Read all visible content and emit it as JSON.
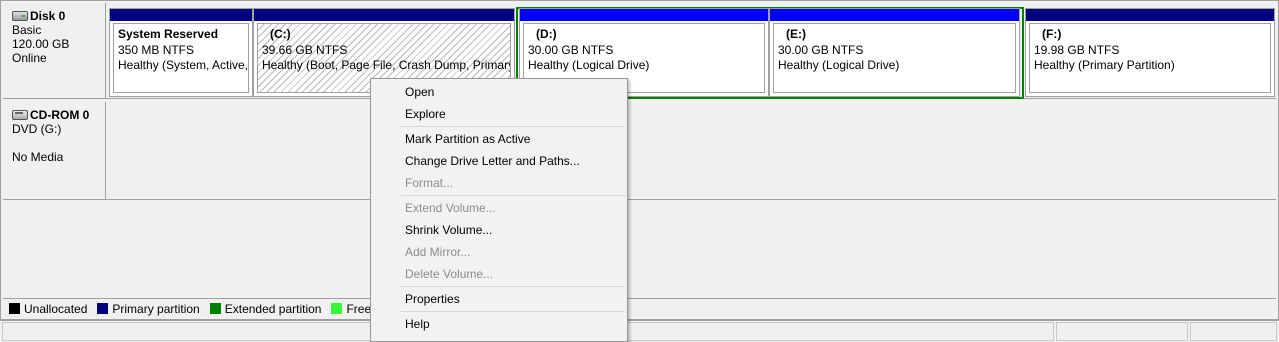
{
  "disks": {
    "disk0": {
      "name": "Disk 0",
      "type": "Basic",
      "size": "120.00 GB",
      "status": "Online",
      "icon": "hard-disk-icon",
      "partitions": [
        {
          "name": "System Reserved",
          "size": "350 MB NTFS",
          "status": "Healthy (System, Active,"
        },
        {
          "name": "(C:)",
          "size": "39.66 GB NTFS",
          "status": "Healthy (Boot, Page File, Crash Dump, Primary"
        },
        {
          "name": "(D:)",
          "size": "30.00 GB NTFS",
          "status": "Healthy (Logical Drive)"
        },
        {
          "name": "(E:)",
          "size": "30.00 GB NTFS",
          "status": "Healthy (Logical Drive)"
        },
        {
          "name": "(F:)",
          "size": "19.98 GB NTFS",
          "status": "Healthy (Primary Partition)"
        }
      ]
    },
    "cdrom0": {
      "name": "CD-ROM 0",
      "type": "DVD (G:)",
      "status": "No Media",
      "icon": "cd-drive-icon"
    }
  },
  "legend": [
    {
      "label": "Unallocated",
      "color": "#000000"
    },
    {
      "label": "Primary partition",
      "color": "#00007f"
    },
    {
      "label": "Extended partition",
      "color": "#008000"
    },
    {
      "label": "Free sp",
      "color": "#33ff33"
    }
  ],
  "context_menu": {
    "items": [
      {
        "label": "Open",
        "enabled": true
      },
      {
        "label": "Explore",
        "enabled": true
      },
      {
        "label": "Mark Partition as Active",
        "enabled": true
      },
      {
        "label": "Change Drive Letter and Paths...",
        "enabled": true
      },
      {
        "label": "Format...",
        "enabled": false
      },
      {
        "label": "Extend Volume...",
        "enabled": false
      },
      {
        "label": "Shrink Volume...",
        "enabled": true
      },
      {
        "label": "Add Mirror...",
        "enabled": false
      },
      {
        "label": "Delete Volume...",
        "enabled": false
      },
      {
        "label": "Properties",
        "enabled": true
      },
      {
        "label": "Help",
        "enabled": true
      }
    ]
  },
  "colors": {
    "primary_bar": "#00007f",
    "logical_bar": "#0000ff",
    "extended_border": "#008000"
  }
}
